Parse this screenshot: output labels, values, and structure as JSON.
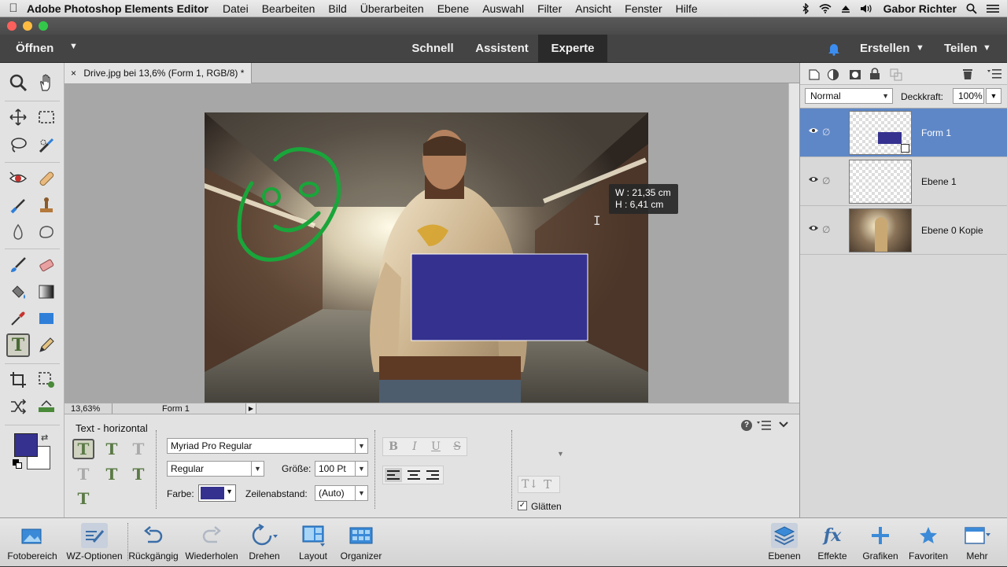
{
  "menubar": {
    "app_name": "Adobe Photoshop Elements Editor",
    "items": [
      "Datei",
      "Bearbeiten",
      "Bild",
      "Überarbeiten",
      "Ebene",
      "Auswahl",
      "Filter",
      "Ansicht",
      "Fenster",
      "Hilfe"
    ],
    "user": "Gabor Richter"
  },
  "modebar": {
    "open_label": "Öffnen",
    "tabs": [
      {
        "label": "Schnell"
      },
      {
        "label": "Assistent"
      },
      {
        "label": "Experte"
      }
    ],
    "active_tab": "Experte",
    "create_label": "Erstellen",
    "share_label": "Teilen"
  },
  "document": {
    "tab_title": "Drive.jpg bei 13,6% (Form 1, RGB/8) *",
    "close_symbol": "×",
    "zoom": "13,63%",
    "status_layer": "Form 1",
    "tooltip": {
      "w": "W : 21,35 cm",
      "h": "H :   6,41 cm"
    },
    "shape_color": "#35318f",
    "drawing_color": "#1aa53a"
  },
  "layers_panel": {
    "blend_mode": "Normal",
    "opacity_label": "Deckkraft:",
    "opacity_value": "100%",
    "layers": [
      {
        "name": "Form 1",
        "selected": true
      },
      {
        "name": "Ebene 1",
        "selected": false
      },
      {
        "name": "Ebene 0 Kopie",
        "selected": false
      }
    ],
    "selection_color": "#5e87c7"
  },
  "tool_options": {
    "title": "Text - horizontal",
    "font_family": "Myriad Pro Regular",
    "font_style": "Regular",
    "size_label": "Größe:",
    "size_value": "100 Pt",
    "color_label": "Farbe:",
    "leading_label": "Zeilenabstand:",
    "leading_value": "(Auto)",
    "format_bold": "B",
    "format_italic": "I",
    "format_underline": "U",
    "format_strike": "S",
    "antialias_label": "Glätten",
    "antialias_checked": true,
    "help": "?"
  },
  "taskbar": {
    "left": [
      {
        "label": "Fotobereich"
      },
      {
        "label": "WZ-Optionen"
      },
      {
        "label": "Rückgängig"
      },
      {
        "label": "Wiederholen"
      },
      {
        "label": "Drehen"
      },
      {
        "label": "Layout"
      },
      {
        "label": "Organizer"
      }
    ],
    "right": [
      {
        "label": "Ebenen"
      },
      {
        "label": "Effekte"
      },
      {
        "label": "Grafiken"
      },
      {
        "label": "Favoriten"
      },
      {
        "label": "Mehr"
      }
    ],
    "effects_icon_text": "fx"
  },
  "colors": {
    "foreground": "#35318f",
    "background": "#ffffff",
    "accent": "#5e87c7"
  }
}
